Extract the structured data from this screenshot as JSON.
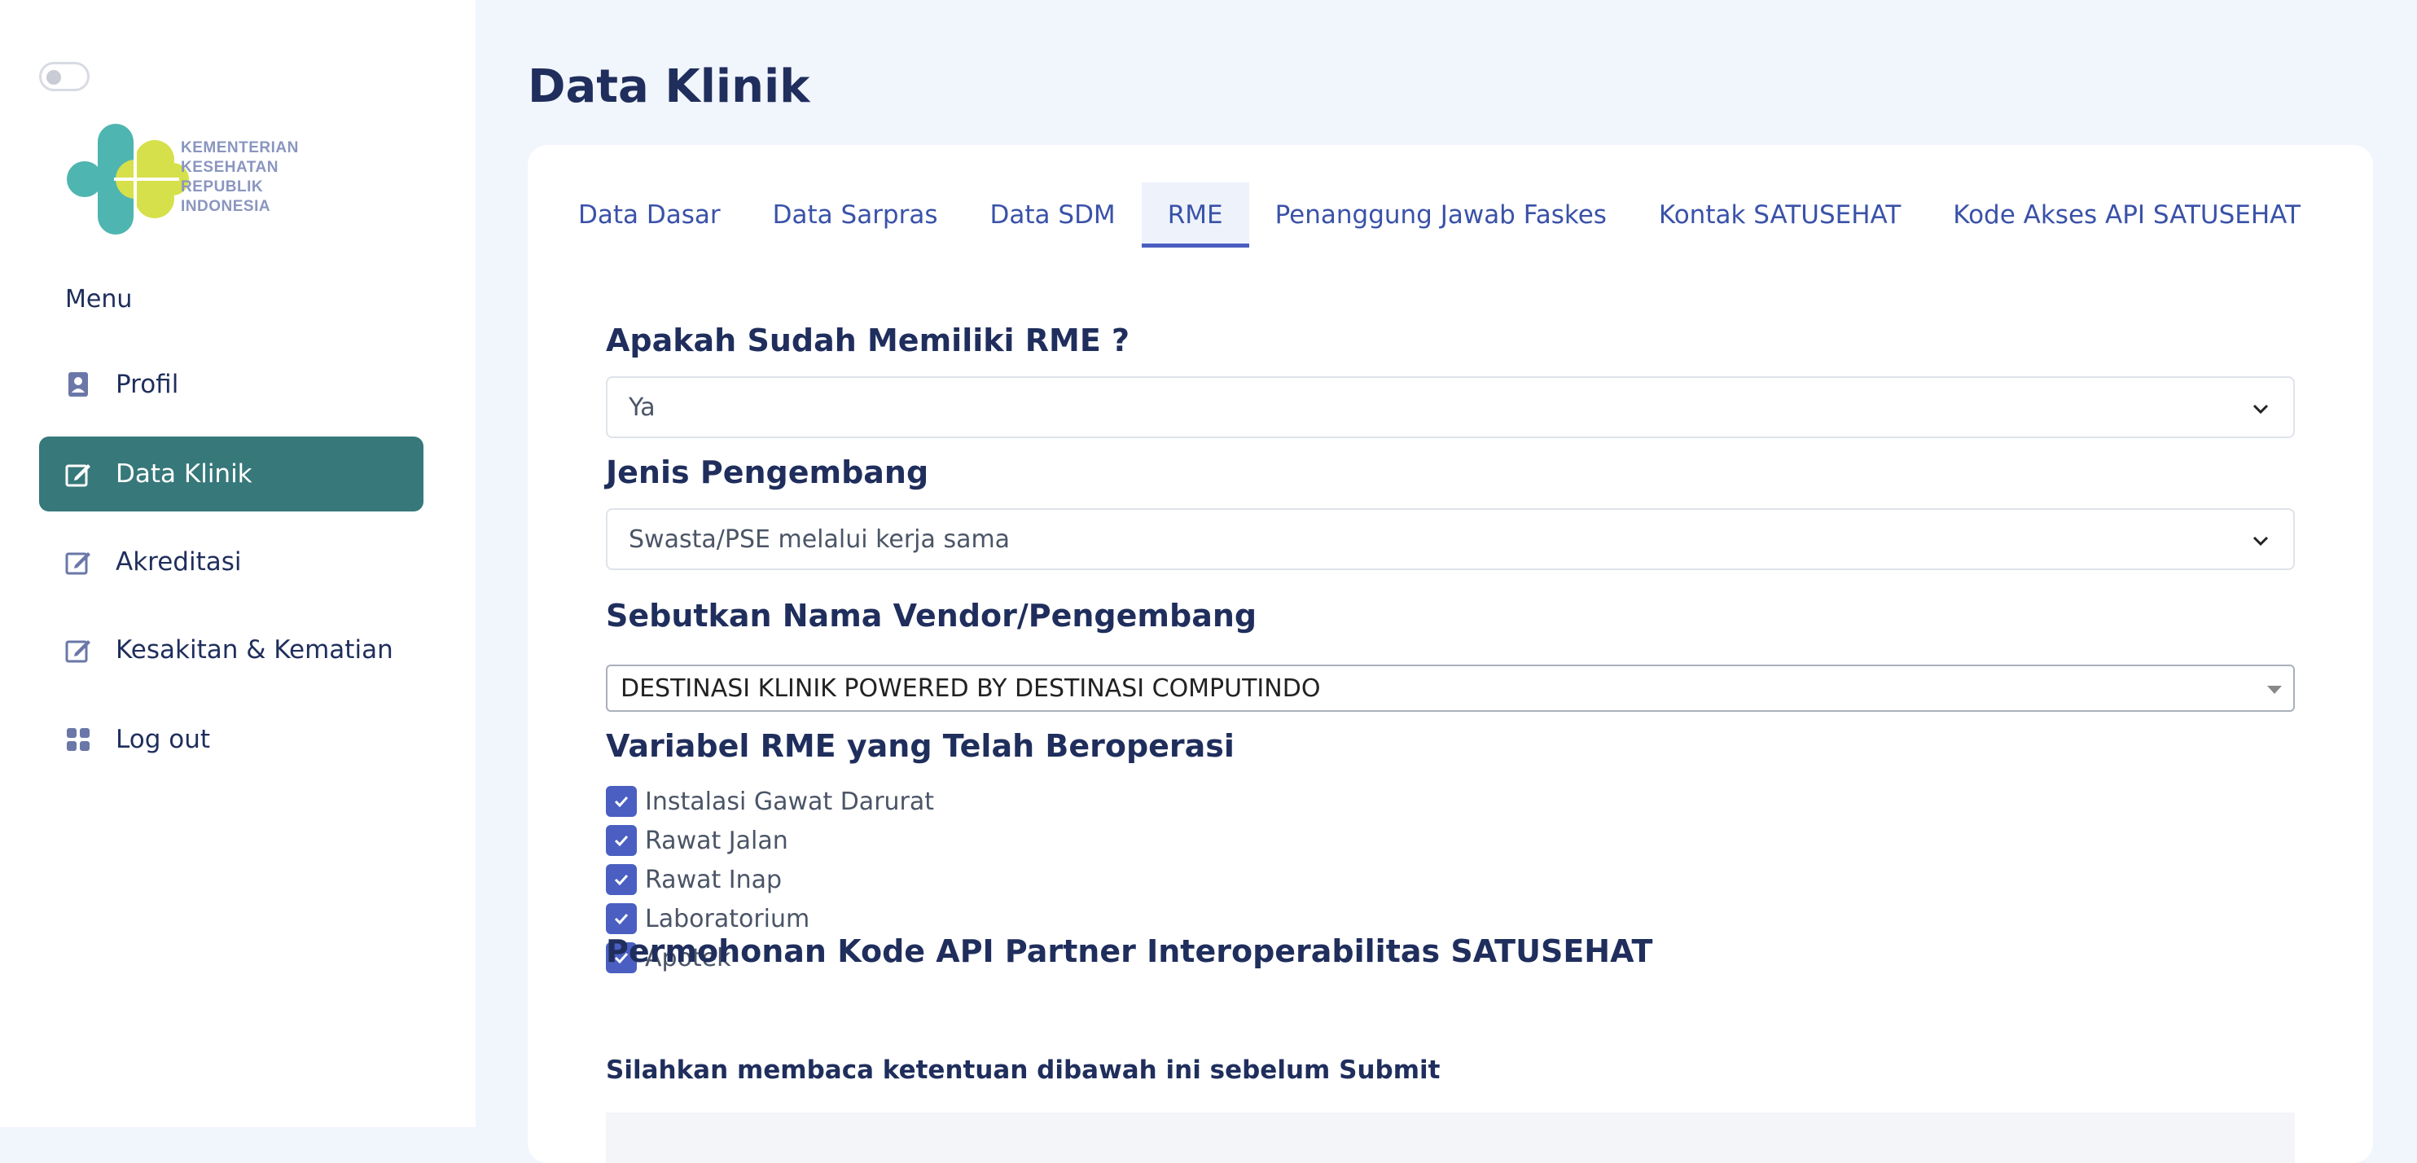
{
  "sidebar": {
    "logo_text": [
      "KEMENTERIAN",
      "KESEHATAN",
      "REPUBLIK",
      "INDONESIA"
    ],
    "menu_title": "Menu",
    "items": [
      {
        "label": "Profil",
        "icon": "contact-book-icon",
        "active": false
      },
      {
        "label": "Data Klinik",
        "icon": "edit-icon",
        "active": true
      },
      {
        "label": "Akreditasi",
        "icon": "edit-icon",
        "active": false
      },
      {
        "label": "Kesakitan & Kematian",
        "icon": "edit-icon",
        "active": false
      },
      {
        "label": "Log out",
        "icon": "grid-icon",
        "active": false
      }
    ]
  },
  "page": {
    "title": "Data Klinik"
  },
  "tabs": [
    {
      "label": "Data Dasar"
    },
    {
      "label": "Data Sarpras"
    },
    {
      "label": "Data SDM"
    },
    {
      "label": "RME",
      "active": true
    },
    {
      "label": "Penanggung Jawab Faskes"
    },
    {
      "label": "Kontak SATUSEHAT"
    },
    {
      "label": "Kode Akses API SATUSEHAT"
    }
  ],
  "form": {
    "rme_question": {
      "label": "Apakah Sudah Memiliki RME ?",
      "value": "Ya"
    },
    "developer_type": {
      "label": "Jenis Pengembang",
      "value": "Swasta/PSE melalui kerja sama"
    },
    "vendor_name": {
      "label": "Sebutkan Nama Vendor/Pengembang",
      "value": "DESTINASI KLINIK POWERED BY DESTINASI COMPUTINDO"
    },
    "variables": {
      "label": "Variabel RME yang Telah Beroperasi",
      "options": [
        {
          "label": "Instalasi Gawat Darurat",
          "checked": true
        },
        {
          "label": "Rawat Jalan",
          "checked": true
        },
        {
          "label": "Rawat Inap",
          "checked": true
        },
        {
          "label": "Laboratorium",
          "checked": true
        },
        {
          "label": "Apotek",
          "checked": true
        }
      ]
    },
    "api_request": {
      "label": "Permohonan Kode API Partner Interoperabilitas SATUSEHAT",
      "note": "Silahkan membaca ketentuan dibawah ini sebelum Submit"
    }
  },
  "colors": {
    "primary": "#4a5fc1",
    "active_nav": "#37787a",
    "heading": "#1f2e5c",
    "background": "#f1f5fc"
  }
}
